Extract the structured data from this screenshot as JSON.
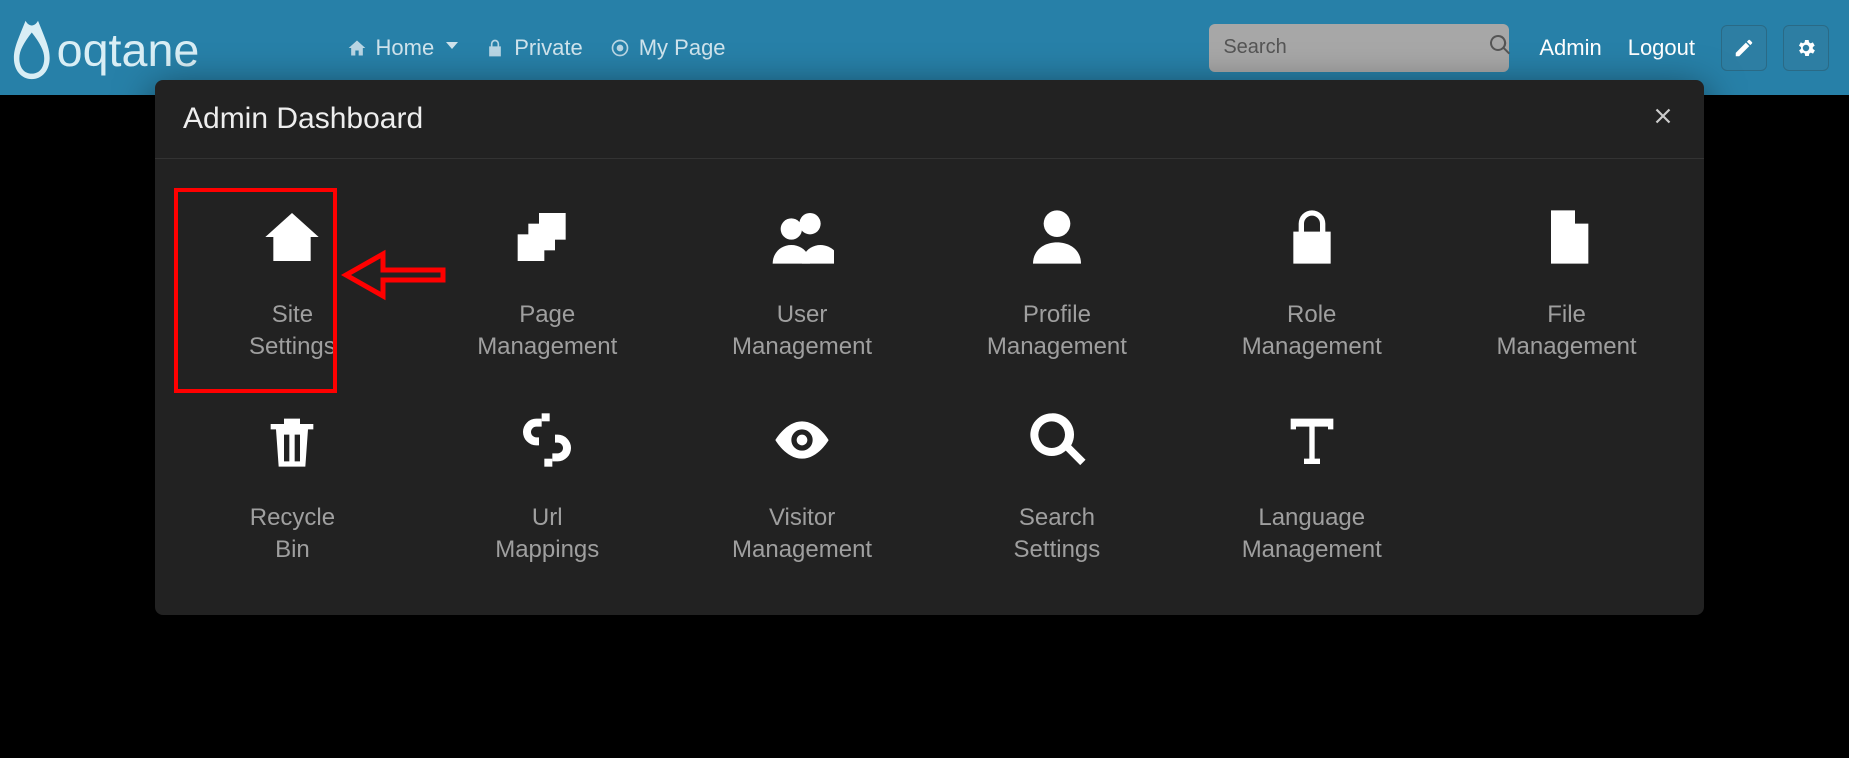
{
  "nav": {
    "home": "Home",
    "private": "Private",
    "mypage": "My Page"
  },
  "search": {
    "placeholder": "Search"
  },
  "toplinks": {
    "admin": "Admin",
    "logout": "Logout"
  },
  "modal": {
    "title": "Admin Dashboard"
  },
  "tiles": {
    "site_settings": "Site\nSettings",
    "page_management": "Page\nManagement",
    "user_management": "User\nManagement",
    "profile_management": "Profile\nManagement",
    "role_management": "Role\nManagement",
    "file_management": "File\nManagement",
    "recycle_bin": "Recycle\nBin",
    "url_mappings": "Url\nMappings",
    "visitor_management": "Visitor\nManagement",
    "search_settings": "Search\nSettings",
    "language_management": "Language\nManagement"
  }
}
